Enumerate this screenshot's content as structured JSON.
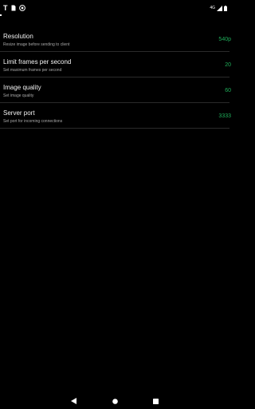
{
  "status_bar": {
    "app_icon_letter": "T",
    "network_label": "4G",
    "icons": [
      "t-app-icon",
      "sim-card-icon",
      "vpn-key-icon",
      "signal-icon",
      "battery-icon"
    ]
  },
  "settings": {
    "items": [
      {
        "title": "Resolution",
        "summary": "Resize image before sending to client",
        "value": "540p"
      },
      {
        "title": "Limit frames per second",
        "summary": "Set maximum frames per second",
        "value": "20"
      },
      {
        "title": "Image quality",
        "summary": "Set image quality",
        "value": "60"
      },
      {
        "title": "Server port",
        "summary": "Set port for incoming connections",
        "value": "3333"
      }
    ]
  },
  "colors": {
    "background": "#000000",
    "accent_value": "#1fae5a",
    "summary_text": "#a8a8a8",
    "divider": "#2a2a2a"
  },
  "navigation_bar": {
    "icons": [
      "back-triangle-icon",
      "home-circle-icon",
      "recents-square-icon"
    ]
  }
}
